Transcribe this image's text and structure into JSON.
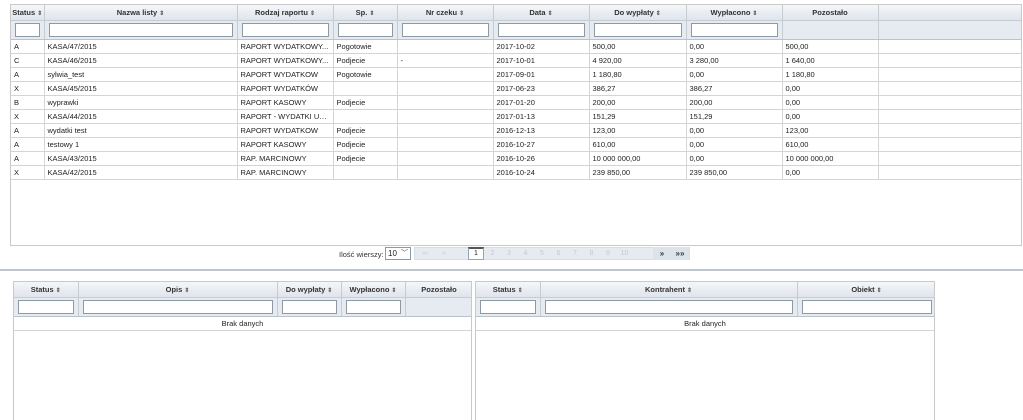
{
  "top_grid": {
    "columns": [
      "Status",
      "Nazwa listy",
      "Rodzaj raportu",
      "Sp.",
      "Nr czeku",
      "Data",
      "Do wypłaty",
      "Wypłacono",
      "Pozostało"
    ],
    "sortable": [
      true,
      true,
      true,
      true,
      true,
      true,
      true,
      true,
      false
    ],
    "sort_icon": "⇕",
    "rows": [
      [
        "A",
        "KASA/47/2015",
        "RAPORT WYDATKOWY...",
        "Pogotowie",
        "",
        "2017-10-02",
        "500,00",
        "0,00",
        "500,00"
      ],
      [
        "C",
        "KASA/46/2015",
        "RAPORT WYDATKOWY...",
        "Podjecie",
        "-",
        "2017-10-01",
        "4 920,00",
        "3 280,00",
        "1 640,00"
      ],
      [
        "A",
        "sylwia_test",
        "RAPORT WYDATKOW",
        "Pogotowie",
        "",
        "2017-09-01",
        "1 180,80",
        "0,00",
        "1 180,80"
      ],
      [
        "X",
        "KASA/45/2015",
        "RAPORT WYDATKÓW",
        "",
        "",
        "2017-06-23",
        "386,27",
        "386,27",
        "0,00"
      ],
      [
        "B",
        "wyprawki",
        "RAPORT KASOWY",
        "Podjecie",
        "",
        "2017-01-20",
        "200,00",
        "200,00",
        "0,00"
      ],
      [
        "X",
        "KASA/44/2015",
        "RAPORT - WYDATKI UR...",
        "",
        "",
        "2017-01-13",
        "151,29",
        "151,29",
        "0,00"
      ],
      [
        "A",
        "wydatki test",
        "RAPORT WYDATKOW",
        "Podjecie",
        "",
        "2016-12-13",
        "123,00",
        "0,00",
        "123,00"
      ],
      [
        "A",
        "testowy 1",
        "RAPORT KASOWY",
        "Podjecie",
        "",
        "2016-10-27",
        "610,00",
        "0,00",
        "610,00"
      ],
      [
        "A",
        "KASA/43/2015",
        "RAP. MARCINOWY",
        "Podjecie",
        "",
        "2016-10-26",
        "10 000 000,00",
        "0,00",
        "10 000 000,00"
      ],
      [
        "X",
        "KASA/42/2015",
        "RAP. MARCINOWY",
        "",
        "",
        "2016-10-24",
        "239 850,00",
        "239 850,00",
        "0,00"
      ]
    ]
  },
  "pager": {
    "rows_label": "Ilość wierszy:",
    "rows_value": "10",
    "first": "«‹",
    "prev": "«",
    "pages": [
      "1",
      "2",
      "3",
      "4",
      "5",
      "6",
      "7",
      "8",
      "9",
      "10"
    ],
    "current_page": "1",
    "next": "»",
    "last": "»»"
  },
  "bottom_left_grid": {
    "columns": [
      "Status",
      "Opis",
      "Do wypłaty",
      "Wypłacono",
      "Pozostało"
    ],
    "sortable": [
      true,
      true,
      true,
      true,
      false
    ],
    "empty_text": "Brak danych"
  },
  "bottom_right_grid": {
    "columns": [
      "Status",
      "Kontrahent",
      "Obiekt"
    ],
    "sortable": [
      true,
      true,
      true
    ],
    "empty_text": "Brak danych"
  }
}
